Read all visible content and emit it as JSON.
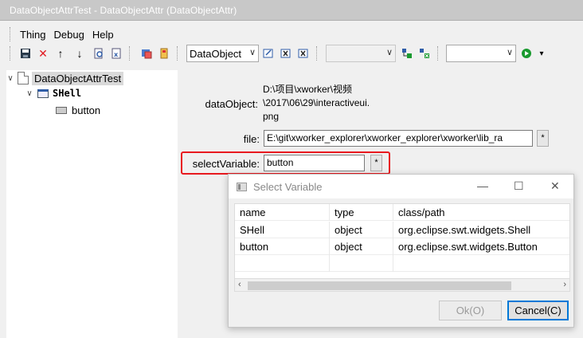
{
  "window": {
    "title": "DataObjectAttrTest - DataObjectAttr  (DataObjectAttr)"
  },
  "menu": {
    "items": [
      "Thing",
      "Debug",
      "Help"
    ]
  },
  "toolbar": {
    "combo1_value": "DataObject",
    "icons": [
      "save-icon",
      "delete-icon",
      "move-up-icon",
      "move-down-icon",
      "find-icon",
      "xml-icon",
      "thing-icon",
      "bookmark-icon",
      "edit-icon",
      "x-icon",
      "x-icon-2",
      "tree-add-icon",
      "tree-remove-icon",
      "run-icon",
      "dropdown-icon"
    ],
    "colors": {
      "delete": "#e11b22",
      "run": "#1a9a2f",
      "accent": "#2f5da8"
    }
  },
  "tree": {
    "root": "DataObjectAttrTest",
    "child": "SHell",
    "grandchild": "button"
  },
  "form": {
    "data_object_label": "dataObject:",
    "data_object_value_lines": [
      "D:\\项目\\xworker\\视频",
      "\\2017\\06\\29\\interactiveui.",
      "png"
    ],
    "file_label": "file:",
    "file_value": "E:\\git\\xworker_explorer\\xworker_explorer\\xworker\\lib_ra",
    "select_variable_label": "selectVariable:",
    "select_variable_value": "button",
    "star": "*",
    "highlight_color": "#e8191f"
  },
  "dialog": {
    "title": "Select Variable",
    "columns": [
      "name",
      "type",
      "class/path"
    ],
    "rows": [
      [
        "SHell",
        "object",
        "org.eclipse.swt.widgets.Shell"
      ],
      [
        "button",
        "object",
        "org.eclipse.swt.widgets.Button"
      ]
    ],
    "ok_label": "Ok(O)",
    "cancel_label": "Cancel(C)"
  }
}
